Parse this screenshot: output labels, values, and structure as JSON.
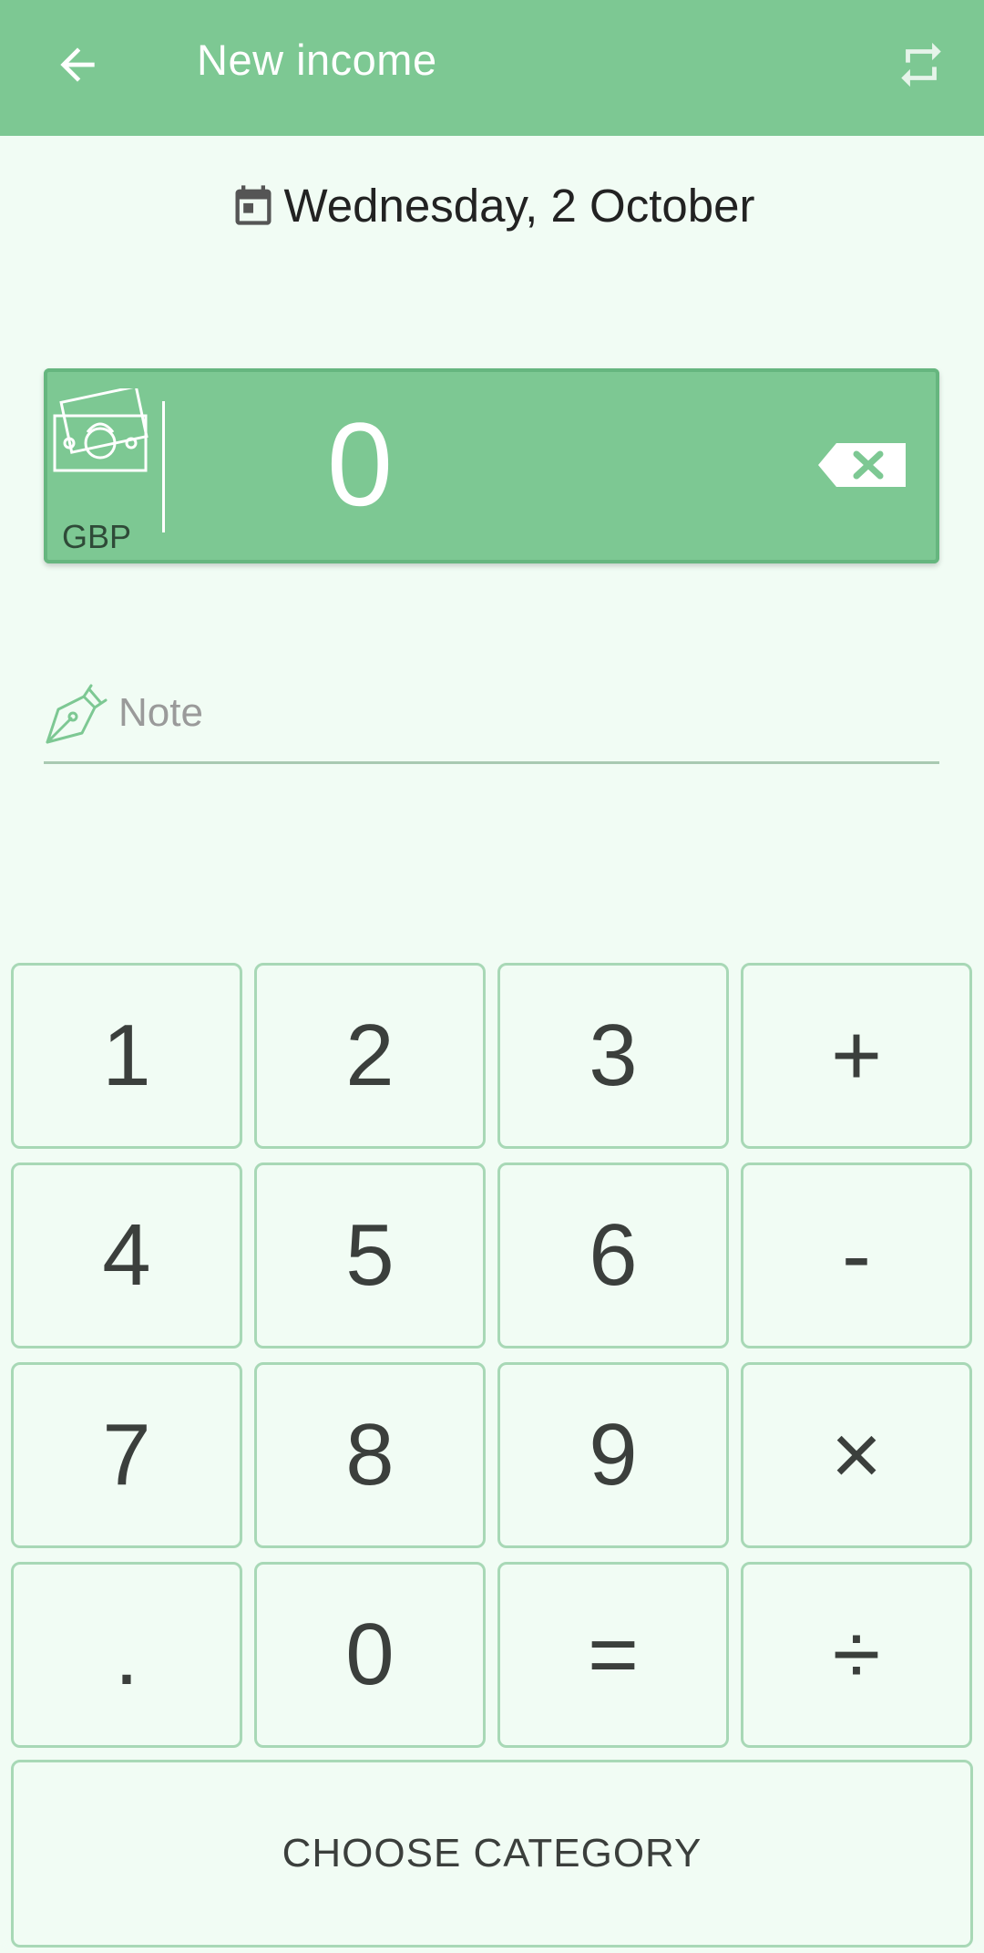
{
  "appbar": {
    "title": "New income",
    "back_icon": "arrow-left-icon",
    "swap_icon": "repeat-icon"
  },
  "date": {
    "icon": "calendar-icon",
    "label": "Wednesday, 2 October"
  },
  "amount": {
    "currency_icon": "banknotes-icon",
    "currency_code": "GBP",
    "value": "0",
    "backspace_icon": "backspace-icon"
  },
  "note": {
    "icon": "pen-nib-icon",
    "placeholder": "Note",
    "value": ""
  },
  "keypad": {
    "keys": [
      "1",
      "2",
      "3",
      "+",
      "4",
      "5",
      "6",
      "-",
      "7",
      "8",
      "9",
      "×",
      ".",
      "0",
      "=",
      "÷"
    ]
  },
  "choose_category_label": "CHOOSE CATEGORY",
  "colors": {
    "appbar": "#7dc893",
    "background": "#f1fcf4",
    "key_border": "#a8d8b6"
  }
}
